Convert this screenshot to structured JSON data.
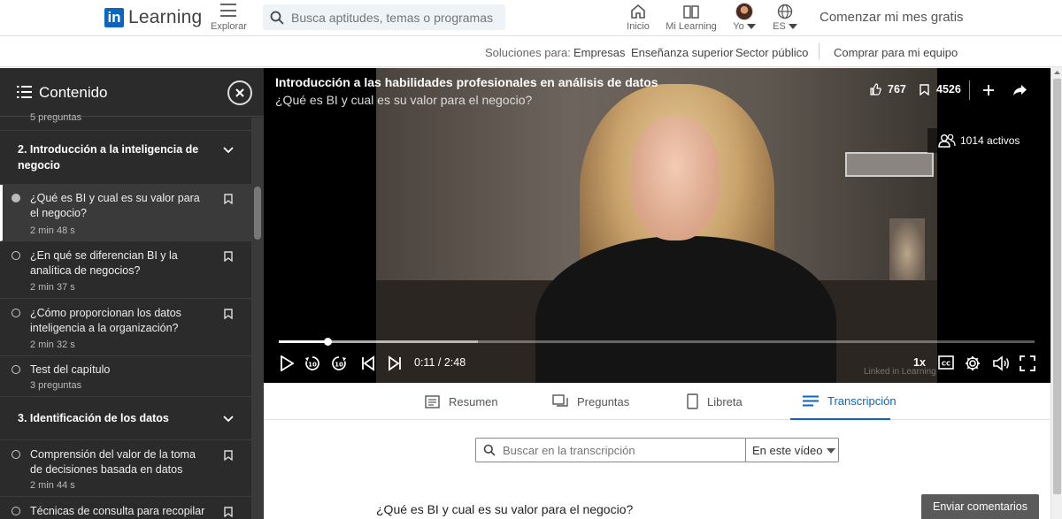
{
  "topnav": {
    "logo_in": "in",
    "logo_word": "Learning",
    "explore_label": "Explorar",
    "search_placeholder": "Busca aptitudes, temas o programas",
    "home_label": "Inicio",
    "mylearning_label": "Mi Learning",
    "me_label": "Yo",
    "lang_label": "ES",
    "cta": "Comenzar mi mes gratis"
  },
  "subnav": {
    "solutions": "Soluciones para:",
    "items": [
      "Empresas",
      "Enseñanza superior",
      "Sector público"
    ],
    "buy": "Comprar para mi equipo"
  },
  "sidebar": {
    "title": "Contenido",
    "prev_subtitle": "5 preguntas",
    "chapter2": "2. Introducción a la inteligencia de negocio",
    "items": [
      {
        "title": "¿Qué es BI y cual es su valor para el negocio?",
        "meta": "2 min 48 s"
      },
      {
        "title": "¿En qué se diferencian BI y la analítica de negocios?",
        "meta": "2 min 37 s"
      },
      {
        "title": "¿Cómo proporcionan los datos inteligencia a la organización?",
        "meta": "2 min 32 s"
      },
      {
        "title": "Test del capítulo",
        "meta": "3 preguntas"
      }
    ],
    "chapter3": "3. Identificación de los datos",
    "items3": [
      {
        "title": "Comprensión del valor de la toma de decisiones basada en datos",
        "meta": "2 min 44 s"
      },
      {
        "title": "Técnicas de consulta para recopilar",
        "meta": ""
      }
    ]
  },
  "video": {
    "title": "Introducción a las habilidades profesionales en análisis de datos",
    "subtitle": "¿Qué es BI y cual es su valor para el negocio?",
    "likes": "767",
    "saves": "4526",
    "active": "1014 activos",
    "time": "0:11 / 2:48",
    "progress_fraction": 0.066,
    "speed": "1x",
    "watermark": "Linked in Learning"
  },
  "tabs": [
    "Resumen",
    "Preguntas",
    "Libreta",
    "Transcripción"
  ],
  "transcript": {
    "search_placeholder": "Buscar en la transcripción",
    "filter": "En este vídeo",
    "heading": "¿Qué es BI y cual es su valor para el negocio?"
  },
  "feedback": "Enviar comentarios",
  "colors": {
    "accent": "#0a66c2",
    "sidebar_bg": "#2b2b2b"
  }
}
